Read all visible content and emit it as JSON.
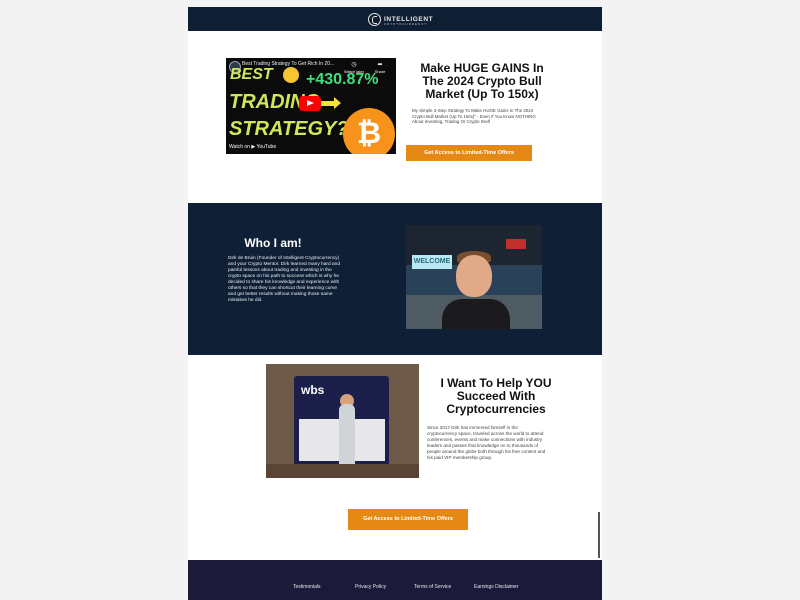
{
  "header": {
    "logo_text": "INTELLIGENT",
    "logo_sub": "CRYPTOCURRENCY"
  },
  "hero": {
    "video": {
      "title": "Best Trading Strategy To Get Rich In 20...",
      "thumb_line1": "BEST",
      "thumb_gain": "+430.87%",
      "thumb_line2": "TRADING",
      "thumb_line3": "STRATEGY?",
      "bitcoin_symbol": "₿",
      "watch_later": "Watch later",
      "share": "Share",
      "watch_on": "Watch on ▶ YouTube"
    },
    "headline": "Make HUGE GAINS In The 2024 Crypto Bull Market (Up To 150x)",
    "body": "My Simple 3-Step Strategy To Make HUGE Gains In The 2024 Crypto Bull Market (Up To 150x)\" - Even If You Know NOTHING About Investing, Trading Or Crypto Itself",
    "cta": "Get Access to Limited-Time Offers"
  },
  "about": {
    "headline": "Who I am!",
    "body": "Dirk de Bruin (Founder of Intelligent Cryptocurrency) and your Crypto Mentor. Dirk learned many hard and painful lessons about trading and investing in the crypto space on his path to success which is why he decided to share his knowledge and experience with others so that they can shortcut their learning curve and get better results without making those same mistakes he did.",
    "photo_banner": "WELCOME"
  },
  "help": {
    "headline": "I Want To Help YOU Succeed With Cryptocurrencies",
    "body": "Since 2017 Dirk has immersed himself in the cryptocurrency space, traveled across the world to attend conferences, events and make connections with industry leaders and passes that knowledge on to thousands of people around the globe both through his free content and his paid VIP membership group.",
    "photo_sign": "wbs",
    "cta": "Get Access to Limited-Time Offers"
  },
  "footer": {
    "links": [
      "Testimonials",
      "Privacy Policy",
      "Terms of Service",
      "Earnings Disclaimer"
    ]
  },
  "colors": {
    "navy": "#0f2036",
    "accent": "#e48a14",
    "footer": "#1b1a3a"
  }
}
